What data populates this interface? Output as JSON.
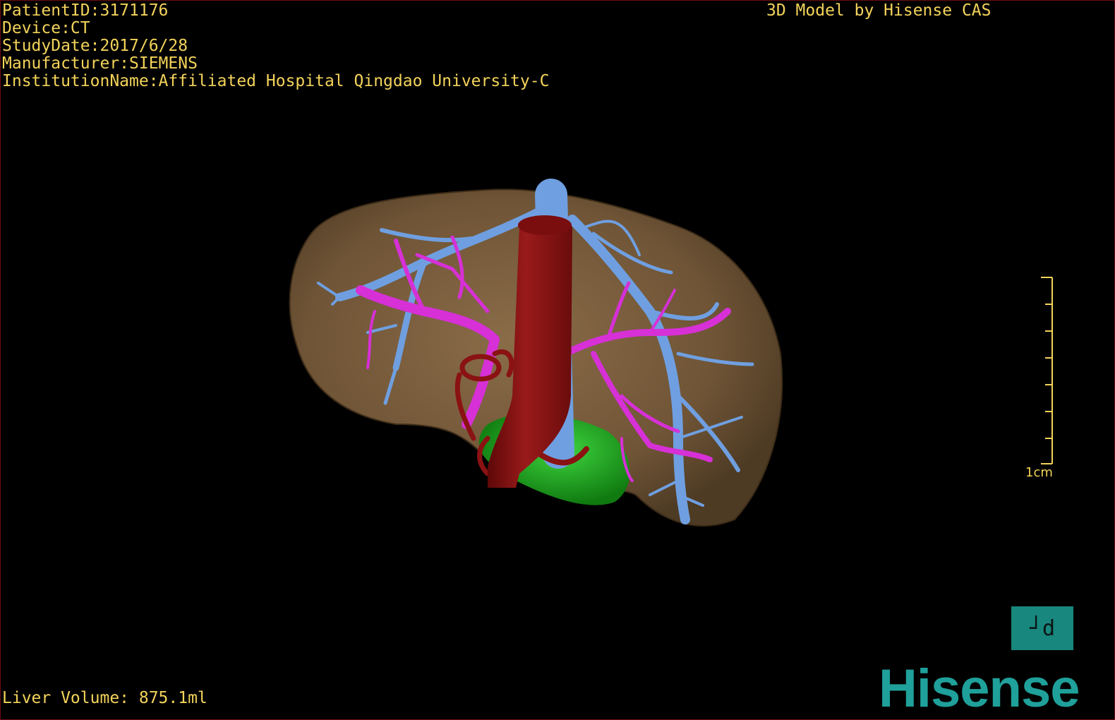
{
  "overlay": {
    "patient_id": "PatientID:3171176",
    "device": "Device:CT",
    "study_date": "StudyDate:2017/6/28",
    "manufacturer": "Manufacturer:SIEMENS",
    "institution": "InstitutionName:Affiliated Hospital Qingdao University-C",
    "credit": "3D Model by Hisense CAS",
    "liver_volume": "Liver Volume: 875.1ml"
  },
  "scale_bar": {
    "label": "1cm"
  },
  "orientation_cube": {
    "label": "┘d"
  },
  "brand": {
    "logo_text": "Hisense"
  },
  "colors": {
    "liver": "#7a5e3f",
    "hepatic_vein": "#6f9fe0",
    "portal_vein": "#d630d6",
    "aorta": "#8a1212",
    "gallbladder": "#16b016",
    "overlay_text": "#f3d35a",
    "brand": "#1fa09a"
  }
}
